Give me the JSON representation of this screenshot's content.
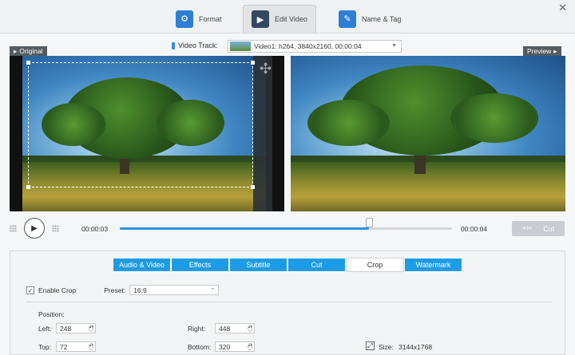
{
  "top_tabs": [
    {
      "label": "Format",
      "icon": "format-icon"
    },
    {
      "label": "Edit Video",
      "icon": "edit-video-icon",
      "active": true
    },
    {
      "label": "Name & Tag",
      "icon": "name-tag-icon"
    }
  ],
  "close_glyph": "✕",
  "video_track": {
    "label": "Video Track:",
    "selected": "Video1: h264, 3840x2160, 00:00:04"
  },
  "original_label": "Original",
  "preview_label": "Preview",
  "playback": {
    "current_time": "00:00:03",
    "total_time": "00:00:04",
    "progress": 0.75,
    "cut_label": "Cut"
  },
  "edit_tabs": [
    {
      "label": "Audio & Video"
    },
    {
      "label": "Effects"
    },
    {
      "label": "Subtitle"
    },
    {
      "label": "Cut"
    },
    {
      "label": "Crop",
      "active": true
    },
    {
      "label": "Watermark"
    }
  ],
  "crop": {
    "enable_label": "Enable Crop",
    "enabled": true,
    "preset_label": "Preset:",
    "preset_value": "16:9",
    "position_label": "Position:",
    "left_label": "Left:",
    "left_value": "248",
    "right_label": "Right:",
    "right_value": "448",
    "top_label": "Top:",
    "top_value": "72",
    "bottom_label": "Bottom:",
    "bottom_value": "320",
    "size_label": "Size:",
    "size_value": "3144x1768"
  },
  "colors": {
    "accent": "#1c9ce6",
    "active_tab_icon": "#34495e"
  }
}
